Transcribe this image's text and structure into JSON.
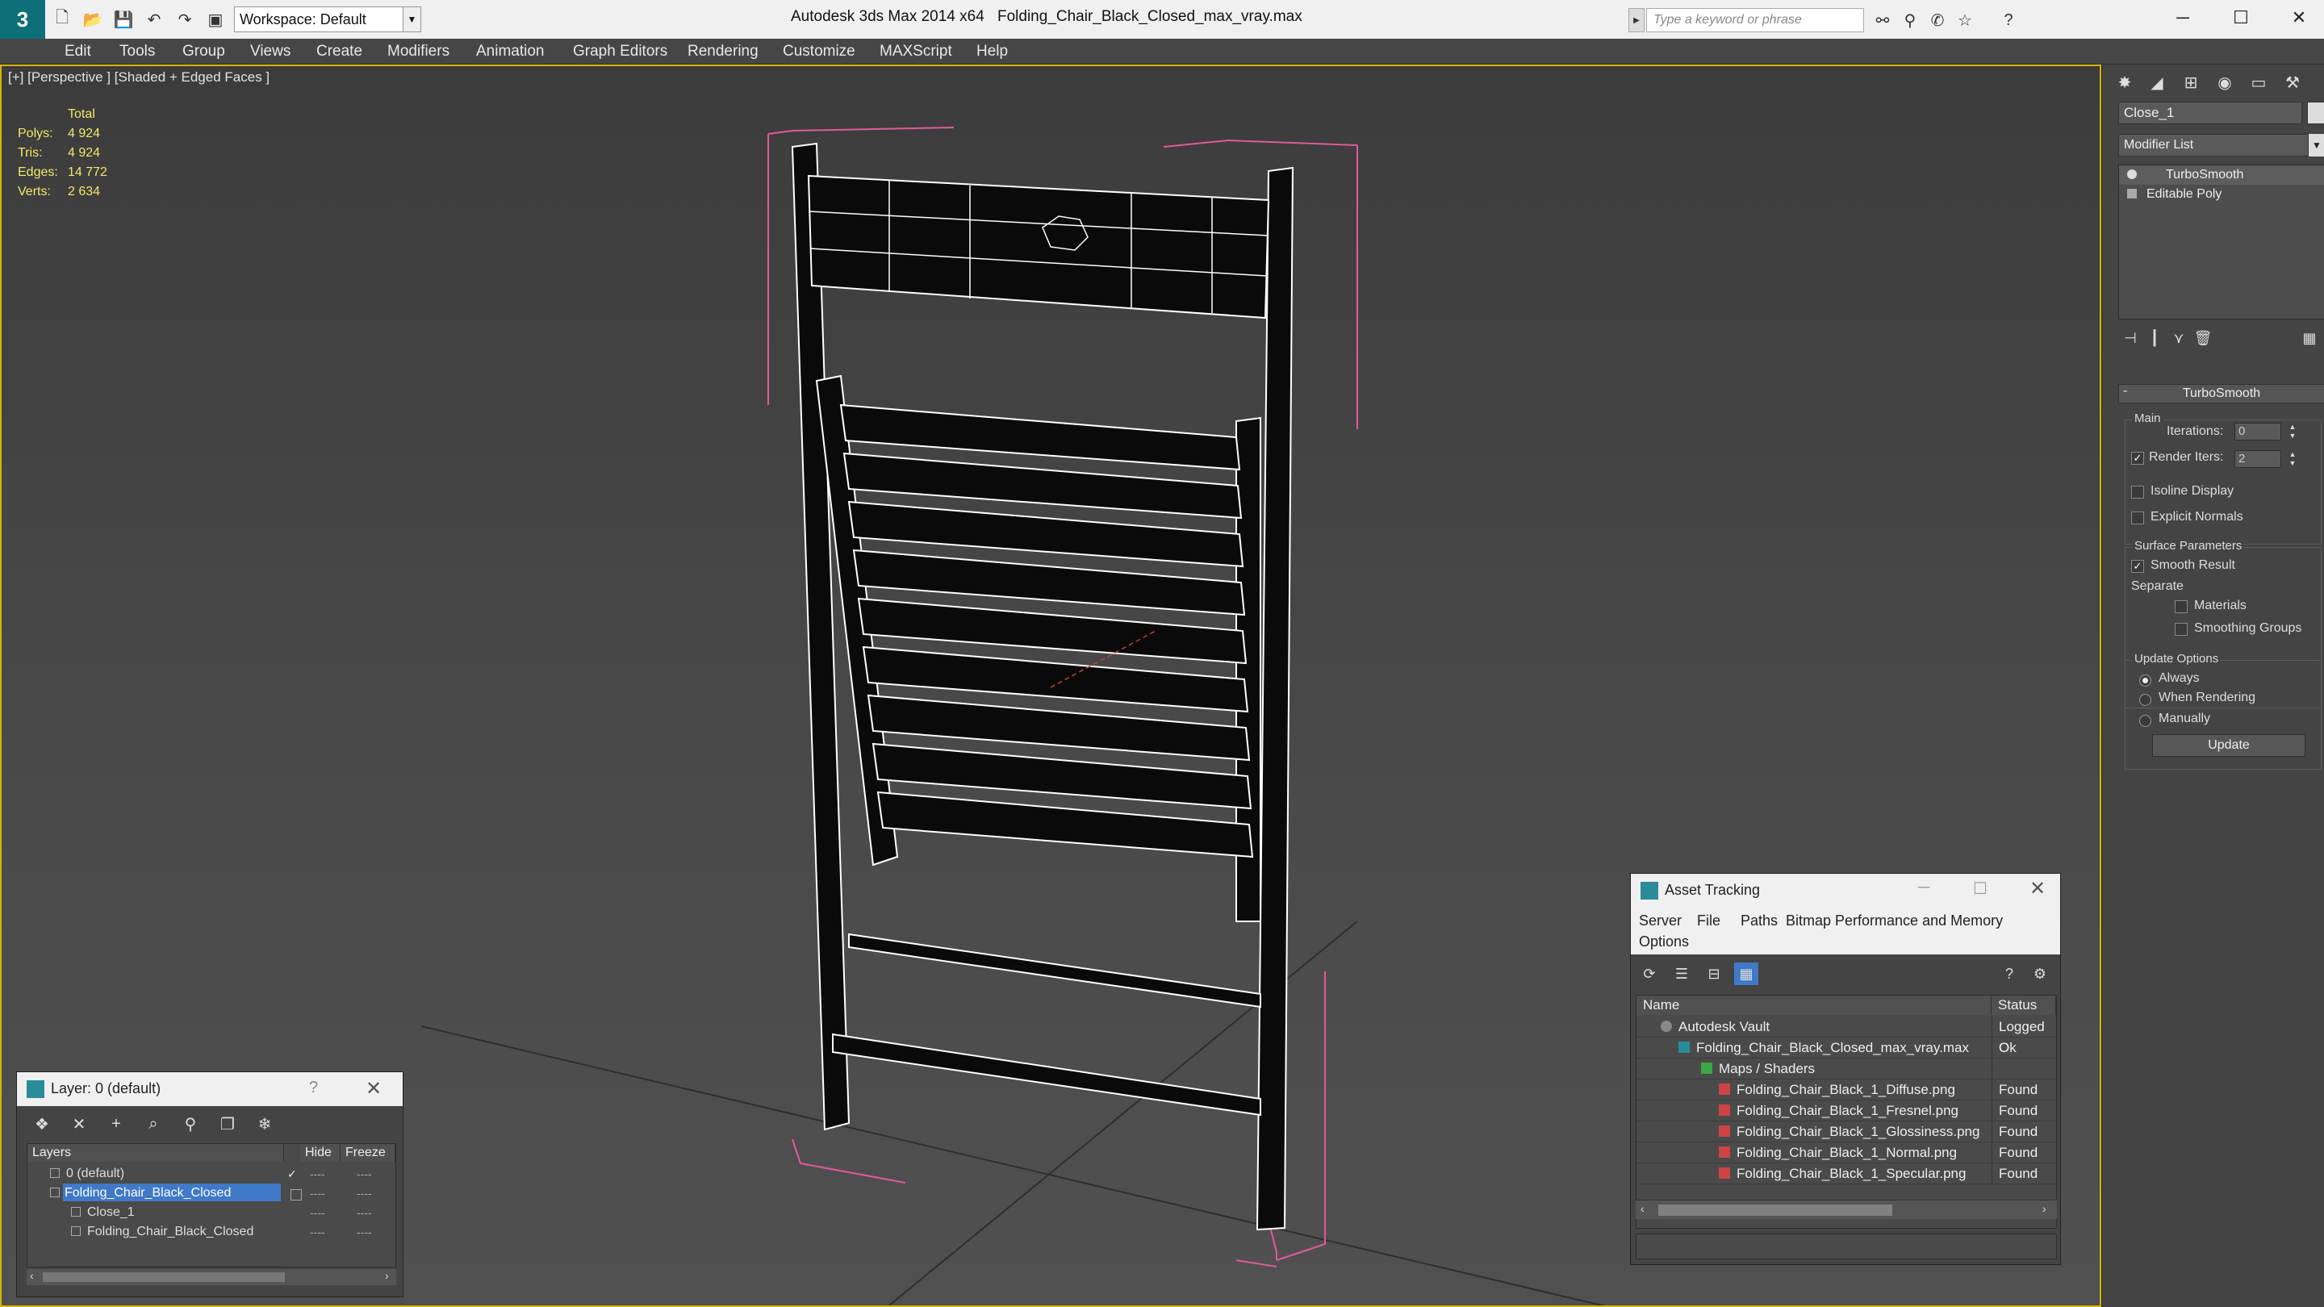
{
  "titlebar": {
    "app_title": "Autodesk 3ds Max  2014 x64",
    "file_title": "Folding_Chair_Black_Closed_max_vray.max",
    "workspace": "Workspace: Default",
    "search_placeholder": "Type a keyword or phrase",
    "logo_letter": "3"
  },
  "menu": [
    "Edit",
    "Tools",
    "Group",
    "Views",
    "Create",
    "Modifiers",
    "Animation",
    "Graph Editors",
    "Rendering",
    "Customize",
    "MAXScript",
    "Help"
  ],
  "viewport": {
    "label": "[+] [Perspective ] [Shaded + Edged Faces ]",
    "stats": {
      "header": "Total",
      "rows": [
        {
          "k": "Polys:",
          "v": "4 924"
        },
        {
          "k": "Tris:",
          "v": "4 924"
        },
        {
          "k": "Edges:",
          "v": "14 772"
        },
        {
          "k": "Verts:",
          "v": "2 634"
        }
      ]
    }
  },
  "command_panel": {
    "object_name": "Close_1",
    "modifier_list": "Modifier List",
    "stack": [
      {
        "label": "TurboSmooth",
        "selected": true
      },
      {
        "label": "Editable Poly",
        "selected": false
      }
    ],
    "rollout_title": "TurboSmooth",
    "main_group": "Main",
    "iterations_label": "Iterations:",
    "iterations_value": "0",
    "render_iters_label": "Render Iters:",
    "render_iters_value": "2",
    "isoline_label": "Isoline Display",
    "explicit_normals_label": "Explicit Normals",
    "surface_group": "Surface Parameters",
    "smooth_result_label": "Smooth Result",
    "separate_label": "Separate",
    "materials_label": "Materials",
    "smoothing_groups_label": "Smoothing Groups",
    "update_group": "Update Options",
    "always_label": "Always",
    "when_rendering_label": "When Rendering",
    "manually_label": "Manually",
    "update_button": "Update"
  },
  "layer_dialog": {
    "title": "Layer: 0 (default)",
    "help": "?",
    "col_layers": "Layers",
    "col_hide": "Hide",
    "col_freeze": "Freeze",
    "rows": [
      {
        "name": "0 (default)",
        "indent": 0,
        "selected": false
      },
      {
        "name": "Folding_Chair_Black_Closed",
        "indent": 0,
        "selected": true
      },
      {
        "name": "Close_1",
        "indent": 1,
        "selected": false
      },
      {
        "name": "Folding_Chair_Black_Closed",
        "indent": 1,
        "selected": false
      }
    ],
    "dash": "----"
  },
  "asset_dialog": {
    "title": "Asset Tracking",
    "menu": [
      "Server",
      "File",
      "Paths",
      "Bitmap Performance and Memory",
      "Options"
    ],
    "col_name": "Name",
    "col_status": "Status",
    "rows": [
      {
        "name": "Autodesk Vault",
        "status": "Logged O",
        "indent": 0,
        "kind": "vault"
      },
      {
        "name": "Folding_Chair_Black_Closed_max_vray.max",
        "status": "Ok",
        "indent": 1,
        "kind": "max"
      },
      {
        "name": "Maps / Shaders",
        "status": "",
        "indent": 2,
        "kind": "folder"
      },
      {
        "name": "Folding_Chair_Black_1_Diffuse.png",
        "status": "Found",
        "indent": 3,
        "kind": "png"
      },
      {
        "name": "Folding_Chair_Black_1_Fresnel.png",
        "status": "Found",
        "indent": 3,
        "kind": "png"
      },
      {
        "name": "Folding_Chair_Black_1_Glossiness.png",
        "status": "Found",
        "indent": 3,
        "kind": "png"
      },
      {
        "name": "Folding_Chair_Black_1_Normal.png",
        "status": "Found",
        "indent": 3,
        "kind": "png"
      },
      {
        "name": "Folding_Chair_Black_1_Specular.png",
        "status": "Found",
        "indent": 3,
        "kind": "png"
      }
    ]
  }
}
